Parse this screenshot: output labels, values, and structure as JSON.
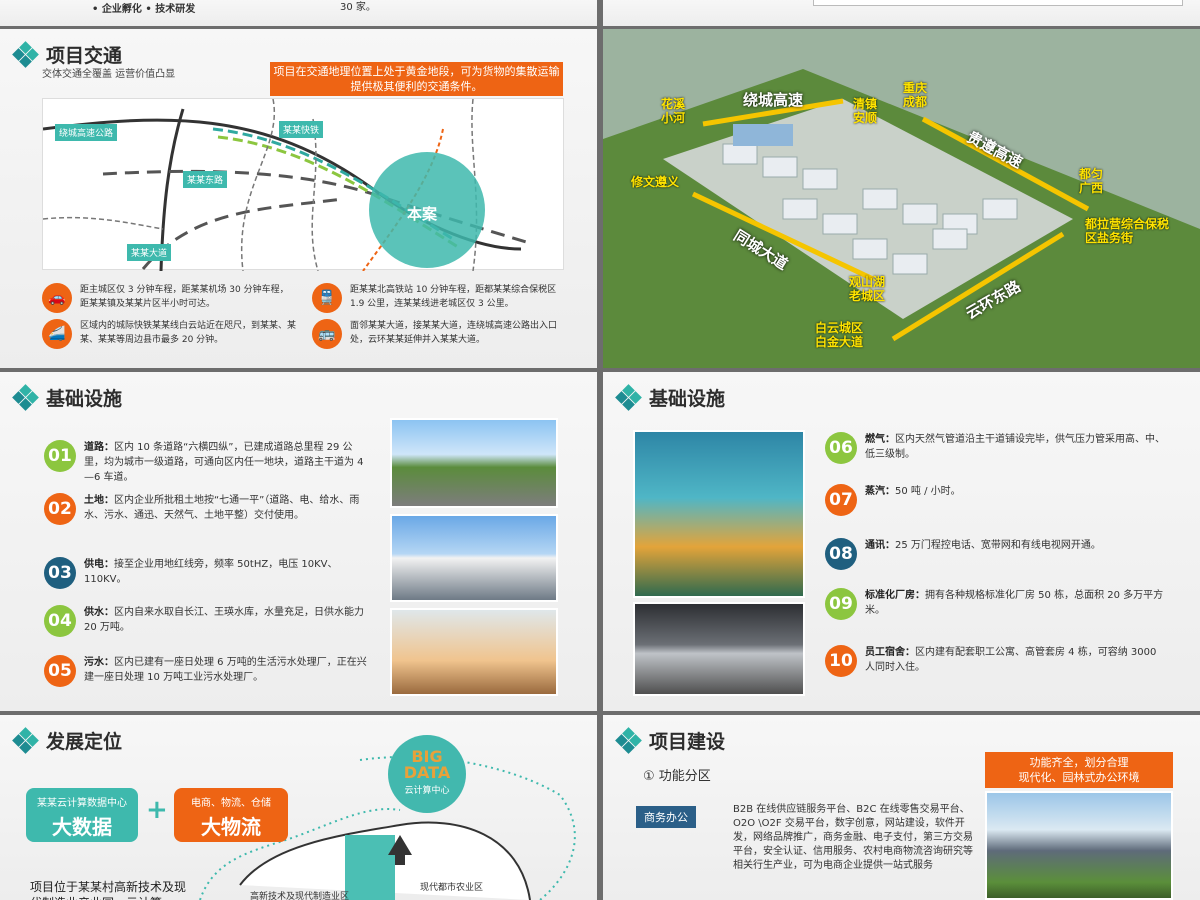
{
  "top_strip": {
    "left_text": "• 企业孵化 • 技术研发",
    "left_mid_text": "30 家。"
  },
  "transport": {
    "title": "项目交通",
    "subtitle": "交体交通全覆盖 运营价值凸显",
    "callout": "项目在交通地理位置上处于黄金地段，可为货物的集散运输提供极其便利的交通条件。",
    "map_labels": {
      "ring_highway": "绕城高速公路",
      "fast_rail": "某某快铁",
      "east_road": "某某东路",
      "avenue": "某某大道",
      "site": "本案"
    },
    "features": [
      {
        "icon": "car-icon",
        "text": "距主城区仅 3 分钟车程，距某某机场 30 分钟车程，距某某镇及某某片区半小时可达。"
      },
      {
        "icon": "train-icon",
        "text": "距某某北高铁站 10 分钟车程，距都某某综合保税区 1.9 公里，连某某线进老城区仅 3 公里。"
      },
      {
        "icon": "highspeed-train-icon",
        "text": "区域内的城际快铁某某线白云站近在咫尺，到某某、某某、某某等周边县市最多 20 分钟。"
      },
      {
        "icon": "bus-icon",
        "text": "面邻某某大道，接某某大道，连绕城高速公路出入口处，云环某某延伸并入某某大道。"
      }
    ]
  },
  "aerial": {
    "labels": {
      "huaxi": "花溪\n小河",
      "ring_high": "绕城高速",
      "qingzhen": "清镇\n安顺",
      "chongqing": "重庆\n成都",
      "guizun": "贵遵高速",
      "duyun": "都匀\n广西",
      "xiuwen": "修文遵义",
      "bonded": "都拉营综合保税\n区盐务街",
      "tongcheng": "同城大道",
      "guanshan": "观山湖\n老城区",
      "yunhuan": "云环东路",
      "baiyun": "白云城区\n白金大道"
    }
  },
  "infra_left": {
    "title": "基础设施",
    "items": [
      {
        "num": "01",
        "color": "#8cc63f",
        "label": "道路：",
        "text": "区内 10 条道路“六横四纵”，已建成道路总里程 29 公里，均为城市一级道路，可通向区内任一地块，道路主干道为 4—6 车道。"
      },
      {
        "num": "02",
        "color": "#ee6414",
        "label": "土地：",
        "text": "区内企业所批租土地按“七通一平”（道路、电、给水、雨水、污水、通迅、天然气、土地平整）交付使用。"
      },
      {
        "num": "03",
        "color": "#1f5f7f",
        "label": "供电：",
        "text": "接至企业用地红线旁，频率 50tHZ，电压 10KV、110KV。"
      },
      {
        "num": "04",
        "color": "#8cc63f",
        "label": "供水：",
        "text": "区内自来水取自长江、王瑛水库，水量充足，日供水能力 20 万吨。"
      },
      {
        "num": "05",
        "color": "#ee6414",
        "label": "污水：",
        "text": "区内已建有一座日处理 6 万吨的生活污水处理厂，正在兴建一座日处理 10 万吨工业污水处理厂。"
      }
    ]
  },
  "infra_right": {
    "title": "基础设施",
    "items": [
      {
        "num": "06",
        "color": "#8cc63f",
        "label": "燃气：",
        "text": "区内天然气管道沿主干道铺设完毕，供气压力管采用高、中、低三级制。"
      },
      {
        "num": "07",
        "color": "#ee6414",
        "label": "蒸汽：",
        "text": "50 吨 / 小时。"
      },
      {
        "num": "08",
        "color": "#1f5f7f",
        "label": "通讯：",
        "text": "25 万门程控电话、宽带网和有线电视网开通。"
      },
      {
        "num": "09",
        "color": "#8cc63f",
        "label": "标准化厂房：",
        "text": "拥有各种规格标准化厂房 50 栋，总面积 20 多万平方米。"
      },
      {
        "num": "10",
        "color": "#ee6414",
        "label": "员工宿舍：",
        "text": "区内建有配套职工公寓、高管套房 4 栋，可容纳 3000 人同时入住。"
      }
    ]
  },
  "positioning": {
    "title": "发展定位",
    "left_pill_small": "某某云计算数据中心",
    "left_pill_big": "大数据",
    "plus": "+",
    "right_pill_small": "电商、物流、仓储",
    "right_pill_big": "大物流",
    "bigdata_big": "BIG\nDATA",
    "bigdata_sub": "云计算中心",
    "body": "项目位于某某村高新技术及现代制造业产业园，云计算",
    "zone_high_tech": "高新技术及现代制造业区",
    "zone_urban_agri": "现代都市农业区"
  },
  "construction": {
    "title": "项目建设",
    "func_title": "①  功能分区",
    "biz_tag": "商务办公",
    "biz_text": "B2B 在线供应链服务平台、B2C 在线零售交易平台、O2O \\O2F 交易平台，数字创意，网站建设，软件开发，网络品牌推广，商务金融、电子支付，第三方交易平台，安全认证、信用服务、农村电商物流咨询研究等相关行生产业，可为电商企业提供一站式服务",
    "banner": "功能齐全，划分合理\n现代化、园林式办公环境"
  }
}
